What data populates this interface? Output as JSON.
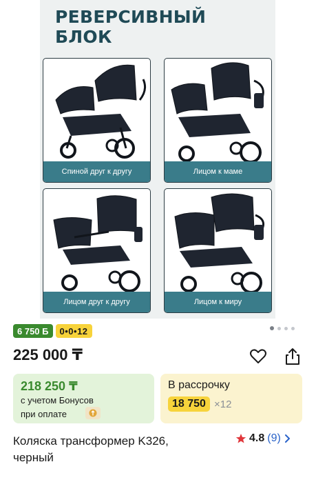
{
  "gallery": {
    "headline": [
      "РЕВЕРСИВНЫЙ",
      "БЛОК"
    ],
    "cards": [
      {
        "caption": "Спиной друг к другу"
      },
      {
        "caption": "Лицом к маме"
      },
      {
        "caption": "Лицом друг к другу"
      },
      {
        "caption": "Лицом к миру"
      }
    ],
    "pager": {
      "count": 4,
      "active_index": 0
    }
  },
  "badges": {
    "bonus": "6 750 Б",
    "installment": "0•0•12"
  },
  "price": "225 000 ₸",
  "bonus_offer": {
    "amount": "218 250 ₸",
    "line1": "с учетом Бонусов",
    "line2": "при оплате"
  },
  "credit_offer": {
    "title": "В рассрочку",
    "monthly": "18 750",
    "times": "×12"
  },
  "product": {
    "title": "Коляска трансформер K326, черный",
    "rating": "4.8",
    "reviews": "(9)"
  },
  "colors": {
    "accent_green": "#3a8a2e",
    "accent_yellow": "#f7d33b",
    "caption_teal": "#3a7c8a",
    "link_blue": "#2a63c9",
    "star_red": "#e0363b"
  }
}
